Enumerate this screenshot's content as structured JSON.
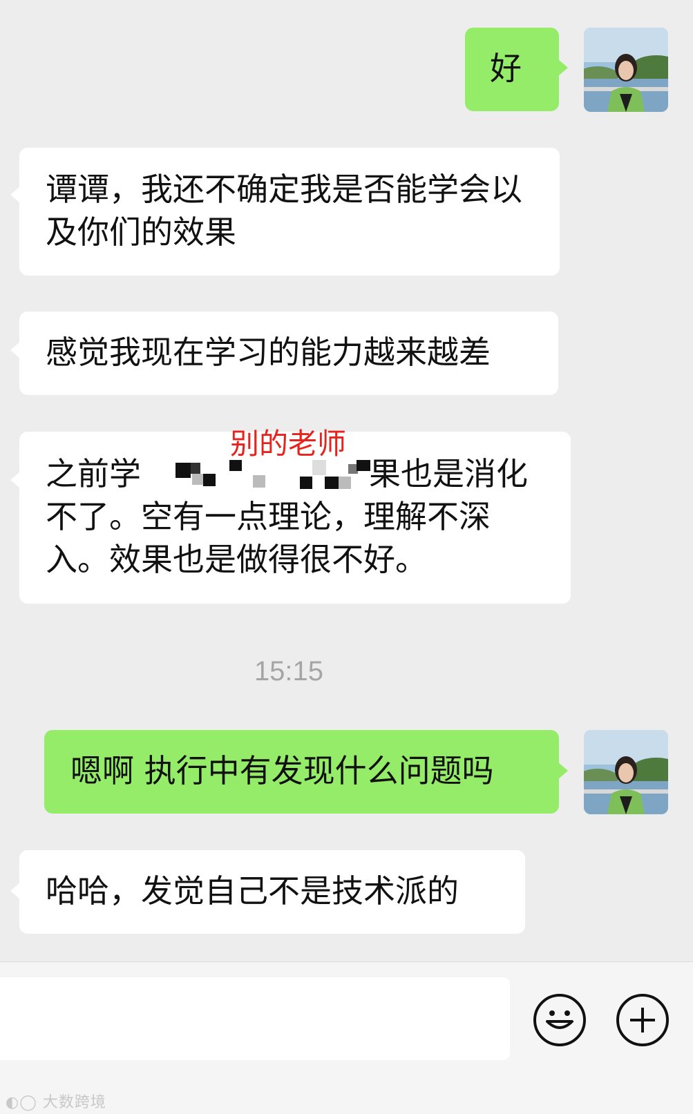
{
  "messages": [
    {
      "text": "好"
    },
    {
      "text": "谭谭，我还不确定我是否能学会以及你们的效果"
    },
    {
      "text": "感觉我现在学习的能力越来越差"
    },
    {
      "text_start": "之前学",
      "text_after_redaction": "果也是消化不了。空有一点理论，理解不深入。效果也是做得很不好。"
    },
    {
      "text": "嗯啊 执行中有发现什么问题吗"
    },
    {
      "text": "哈哈，发觉自己不是技术派的"
    }
  ],
  "annotation": "别的老师",
  "timestamp": "15:15",
  "watermark": "大数跨境",
  "icons": {
    "emoji": "smiley-icon",
    "more": "plus-icon"
  },
  "colors": {
    "background": "#ededed",
    "incoming_bubble": "#ffffff",
    "outgoing_bubble": "#95ec69",
    "annotation": "#e8231d",
    "timestamp": "#a5a5a5"
  }
}
